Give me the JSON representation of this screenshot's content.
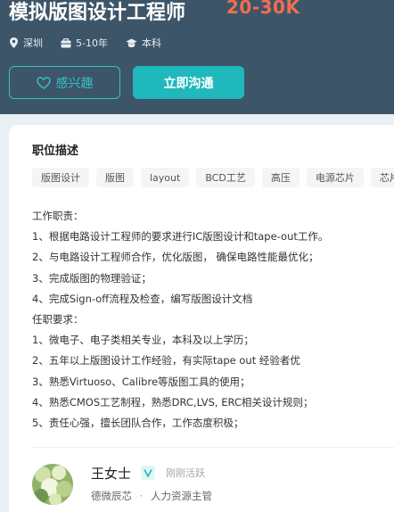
{
  "job": {
    "title": "模拟版图设计工程师",
    "salary": "20-30K",
    "location": "深圳",
    "experience": "5-10年",
    "education": "本科"
  },
  "actions": {
    "interest_label": "感兴趣",
    "chat_label": "立即沟通"
  },
  "description": {
    "section_title": "职位描述",
    "tags": [
      "版图设计",
      "版图",
      "layout",
      "BCD工艺",
      "高压",
      "电源芯片",
      "芯片"
    ],
    "lines": [
      "工作职责：",
      "1、根据电路设计工程师的要求进行IC版图设计和tape-out工作。",
      "2、与电路设计工程师合作，优化版图， 确保电路性能最优化；",
      "3、完成版图的物理验证；",
      "4、完成Sign-off流程及检查，编写版图设计文档",
      "任职要求：",
      "1、微电子、电子类相关专业，本科及以上学历；",
      "2、五年以上版图设计工作经验，有实际tape out 经验者优",
      "3、熟悉Virtuoso、Calibre等版图工具的使用；",
      "4、熟悉CMOS工艺制程，熟悉DRC,LVS, ERC相关设计规则；",
      "5、责任心强，擅长团队合作，工作态度积极；"
    ]
  },
  "recruiter": {
    "name": "王女士",
    "active_status": "刚刚活跃",
    "company": "德微辰芯",
    "separator": "·",
    "role": "人力资源主管"
  },
  "icons": {
    "location": "location-pin-icon",
    "experience": "briefcase-icon",
    "education": "graduation-cap-icon",
    "interest": "heart-outline-icon",
    "verified": "verified-v-icon"
  },
  "colors": {
    "header_bg": "#3d5568",
    "salary": "#f26d50",
    "accent": "#1fb8bd"
  }
}
